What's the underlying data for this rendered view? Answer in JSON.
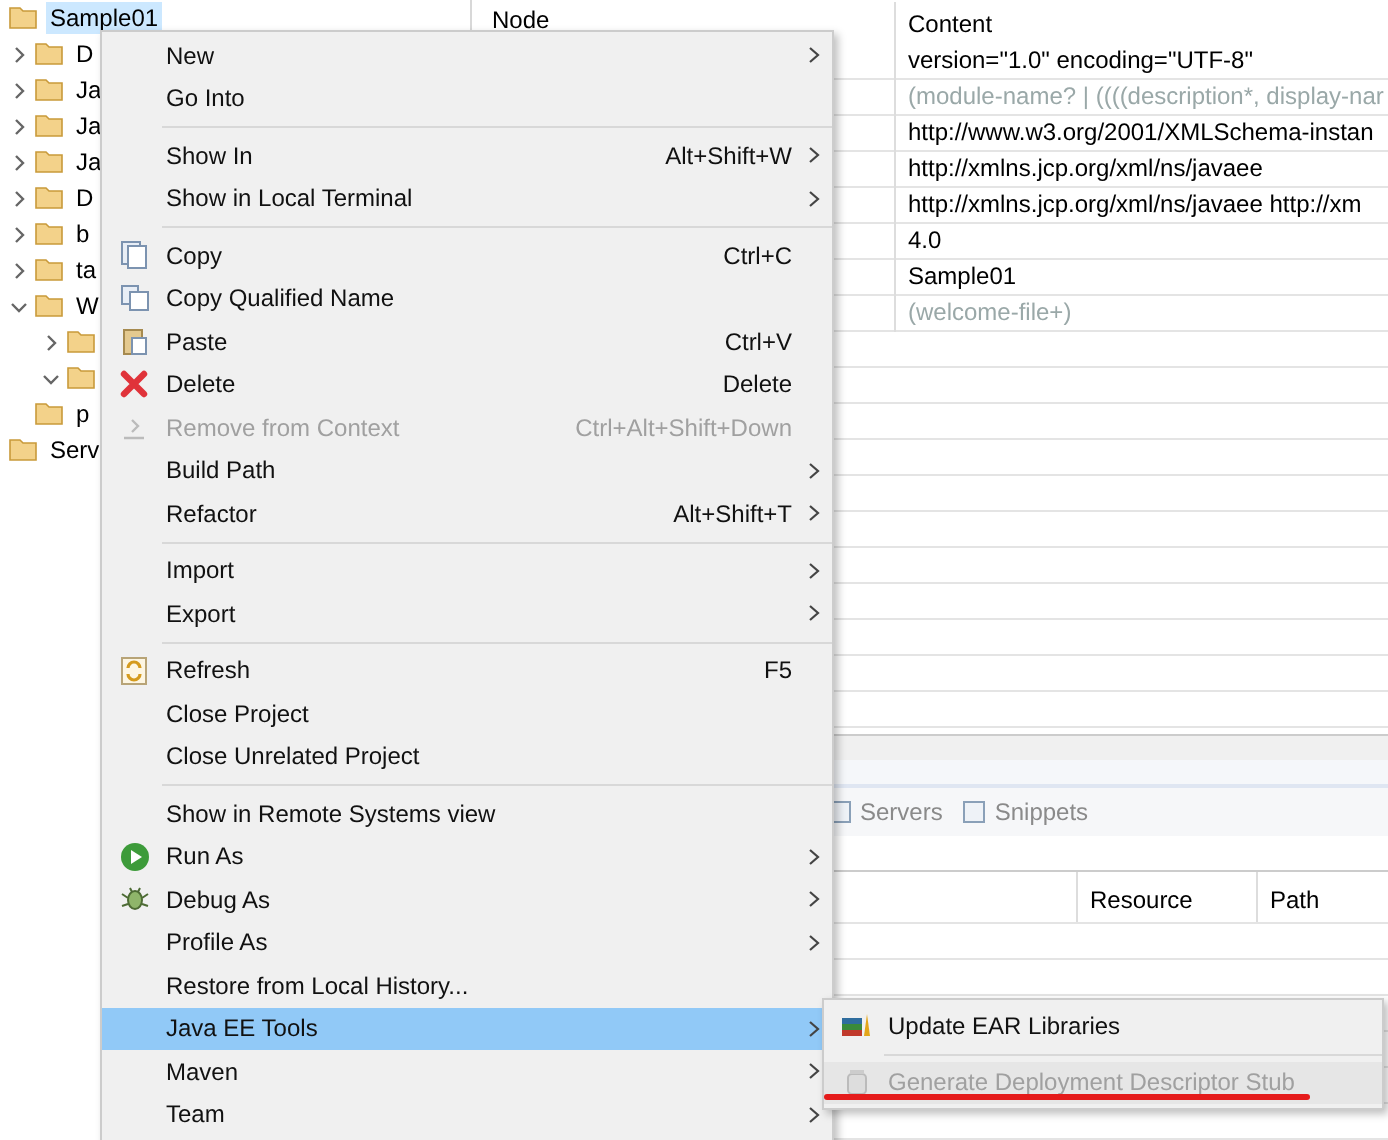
{
  "tree": [
    {
      "label": "Sample01",
      "selected": true,
      "children": [
        {
          "label": "D",
          "expanded": false
        },
        {
          "label": "Ja",
          "expanded": false
        },
        {
          "label": "Ja",
          "expanded": false
        },
        {
          "label": "Ja",
          "expanded": false
        },
        {
          "label": "D",
          "expanded": false
        },
        {
          "label": "b",
          "expanded": false
        },
        {
          "label": "ta",
          "expanded": false
        },
        {
          "label": "W",
          "expanded": true,
          "children": [
            {
              "expanded": false
            },
            {
              "expanded": true
            }
          ]
        },
        {
          "label": "p"
        }
      ]
    },
    {
      "label": "Serv"
    }
  ],
  "editor": {
    "columns": [
      "Node",
      "Content"
    ],
    "rows": [
      {
        "content": "version=\"1.0\" encoding=\"UTF-8\"",
        "kind": "value"
      },
      {
        "content": "(module-name? | ((((description*, display-nar",
        "kind": "hint"
      },
      {
        "content": "http://www.w3.org/2001/XMLSchema-instan",
        "kind": "value"
      },
      {
        "content": "http://xmlns.jcp.org/xml/ns/javaee",
        "kind": "value"
      },
      {
        "content": "http://xmlns.jcp.org/xml/ns/javaee http://xm",
        "kind": "value"
      },
      {
        "content": "4.0",
        "kind": "value"
      },
      {
        "content": "Sample01",
        "kind": "value"
      },
      {
        "content": "(welcome-file+)",
        "kind": "hint"
      }
    ]
  },
  "bottom_panel": {
    "tabs": [
      {
        "label": "Servers",
        "selected": false
      },
      {
        "label": "Snippets",
        "selected": false
      }
    ],
    "columns": [
      "Resource",
      "Path"
    ]
  },
  "context_menu": [
    {
      "kind": "item",
      "label": "New",
      "submenu": true
    },
    {
      "kind": "item",
      "label": "Go Into"
    },
    {
      "kind": "separator"
    },
    {
      "kind": "item",
      "label": "Show In",
      "shortcut": "Alt+Shift+W",
      "submenu": true
    },
    {
      "kind": "item",
      "label": "Show in Local Terminal",
      "submenu": true
    },
    {
      "kind": "separator"
    },
    {
      "kind": "item",
      "label": "Copy",
      "shortcut": "Ctrl+C"
    },
    {
      "kind": "item",
      "label": "Copy Qualified Name"
    },
    {
      "kind": "item",
      "label": "Paste",
      "shortcut": "Ctrl+V"
    },
    {
      "kind": "item",
      "label": "Delete",
      "shortcut": "Delete"
    },
    {
      "kind": "item",
      "label": "Remove from Context",
      "shortcut": "Ctrl+Alt+Shift+Down",
      "disabled": true
    },
    {
      "kind": "item",
      "label": "Build Path",
      "submenu": true
    },
    {
      "kind": "item",
      "label": "Refactor",
      "shortcut": "Alt+Shift+T",
      "submenu": true
    },
    {
      "kind": "separator"
    },
    {
      "kind": "item",
      "label": "Import",
      "submenu": true
    },
    {
      "kind": "item",
      "label": "Export",
      "submenu": true
    },
    {
      "kind": "separator"
    },
    {
      "kind": "item",
      "label": "Refresh",
      "shortcut": "F5"
    },
    {
      "kind": "item",
      "label": "Close Project"
    },
    {
      "kind": "item",
      "label": "Close Unrelated Project"
    },
    {
      "kind": "separator"
    },
    {
      "kind": "item",
      "label": "Show in Remote Systems view"
    },
    {
      "kind": "item",
      "label": "Run As",
      "submenu": true
    },
    {
      "kind": "item",
      "label": "Debug As",
      "submenu": true
    },
    {
      "kind": "item",
      "label": "Profile As",
      "submenu": true
    },
    {
      "kind": "item",
      "label": "Restore from Local History..."
    },
    {
      "kind": "item",
      "label": "Java EE Tools",
      "submenu": true,
      "selected": true
    },
    {
      "kind": "item",
      "label": "Maven",
      "submenu": true
    },
    {
      "kind": "item",
      "label": "Team",
      "submenu": true
    }
  ],
  "submenu": [
    {
      "kind": "item",
      "label": "Update EAR Libraries",
      "disabled": false
    },
    {
      "kind": "separator"
    },
    {
      "kind": "item",
      "label": "Generate Deployment Descriptor Stub",
      "disabled": true,
      "underlined": true
    }
  ]
}
